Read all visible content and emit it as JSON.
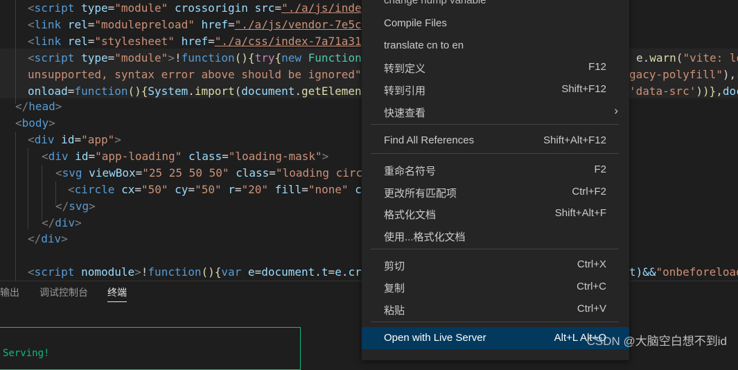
{
  "code": {
    "l1": {
      "a": "<",
      "b": "script",
      "c": " type",
      "d": "=",
      "e": "\"module\"",
      "f": " crossorigin",
      "g": " src",
      "h": "=",
      "i": "\"./a/js/inde"
    },
    "l2": {
      "a": "<",
      "b": "link",
      "c": " rel",
      "d": "=",
      "e": "\"modulepreload\"",
      "f": " href",
      "g": "=",
      "h": "\"./a/js/vendor-7e5c"
    },
    "l3": {
      "a": "<",
      "b": "link",
      "c": " rel",
      "d": "=",
      "e": "\"stylesheet\"",
      "f": " href",
      "g": "=",
      "h": "\"./a/css/index-7a71a31"
    },
    "l4": {
      "a": "<",
      "b": "script",
      "c": " type",
      "d": "=",
      "e": "\"module\"",
      "f": ">",
      "g": "!",
      "h": "function",
      "i": "(){",
      "j": "try",
      "k": "{",
      "l": "new",
      "m": " Function",
      "n": "e.",
      "o": "warn",
      "p": "(",
      "q": "\"vite: loa"
    },
    "l5": {
      "a": "unsupported, syntax error above should be ignored\"",
      "b": "gacy-polyfill\"",
      "c": "),r"
    },
    "l6": {
      "a": "onload",
      "b": "=",
      "c": "function",
      "d": "(){",
      "e": "System",
      "f": ".",
      "g": "import",
      "h": "(",
      "i": "document",
      "j": ".",
      "k": "getElemen",
      "l": "'data-src'",
      "m": "))},",
      "n": "doc"
    },
    "l7": {
      "a": "</",
      "b": "head",
      "c": ">"
    },
    "l8": {
      "a": "<",
      "b": "body",
      "c": ">"
    },
    "l9": {
      "a": "<",
      "b": "div",
      "c": " id",
      "d": "=",
      "e": "\"app\"",
      "f": ">"
    },
    "l10": {
      "a": "<",
      "b": "div",
      "c": " id",
      "d": "=",
      "e": "\"app-loading\"",
      "f": " class",
      "g": "=",
      "h": "\"loading-mask\"",
      "i": ">"
    },
    "l11": {
      "a": "<",
      "b": "svg",
      "c": " viewBox",
      "d": "=",
      "e": "\"25 25 50 50\"",
      "f": " class",
      "g": "=",
      "h": "\"loading circ"
    },
    "l12": {
      "a": "<",
      "b": "circle",
      "c": " cx",
      "d": "=",
      "e": "\"50\"",
      "f": " cy",
      "g": "=",
      "h": "\"50\"",
      "i": " r",
      "j": "=",
      "k": "\"20\"",
      "l": " fill",
      "m": "=",
      "n": "\"none\"",
      "o": " c"
    },
    "l13": {
      "a": "</",
      "b": "svg",
      "c": ">"
    },
    "l14": {
      "a": "</",
      "b": "div",
      "c": ">"
    },
    "l15": {
      "a": "</",
      "b": "div",
      "c": ">"
    },
    "l16": {
      "a": "<",
      "b": "script",
      "c": " nomodule",
      "d": ">",
      "e": "!",
      "f": "function",
      "g": "(){",
      "h": "var",
      "i": " e",
      "j": "=",
      "k": "document",
      "l": ".",
      "m": "t",
      "n": "=",
      "o": "e",
      "p": ".",
      "q": "cr",
      "r": "t)&&",
      "s": "\"onbeforeload"
    }
  },
  "panel": {
    "tabs": [
      "输出",
      "调试控制台",
      "终端"
    ],
    "active_tab": "终端",
    "terminal_text": "Serving!"
  },
  "menu": {
    "top_partial": "change nump variable",
    "items": [
      {
        "label": "Compile Files",
        "key": ""
      },
      {
        "label": "translate cn to en",
        "key": ""
      },
      {
        "label": "转到定义",
        "key": "F12"
      },
      {
        "label": "转到引用",
        "key": "Shift+F12"
      },
      {
        "label": "快速查看",
        "key": ""
      },
      {
        "label": "Find All References",
        "key": "Shift+Alt+F12"
      },
      {
        "label": "重命名符号",
        "key": "F2"
      },
      {
        "label": "更改所有匹配项",
        "key": "Ctrl+F2"
      },
      {
        "label": "格式化文档",
        "key": "Shift+Alt+F"
      },
      {
        "label": "使用...格式化文档",
        "key": ""
      },
      {
        "label": "剪切",
        "key": "Ctrl+X"
      },
      {
        "label": "复制",
        "key": "Ctrl+C"
      },
      {
        "label": "粘贴",
        "key": "Ctrl+V"
      },
      {
        "label": "Open with Live Server",
        "key": "Alt+L Alt+O"
      }
    ]
  },
  "watermark": "CSDN @大脑空白想不到id",
  "icons": {
    "submenu": "chevron-right-icon"
  },
  "colors": {
    "menu_bg": "#252526",
    "menu_active": "#04395e",
    "terminal_green": "#0dbc79",
    "editor_bg": "#1e1e1e"
  }
}
